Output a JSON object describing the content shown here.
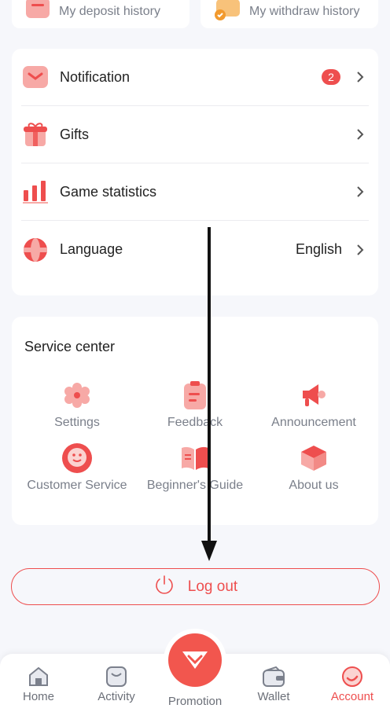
{
  "top": {
    "deposit_history_label": "My deposit history",
    "withdraw_history_label": "My withdraw history"
  },
  "menu": {
    "notification": {
      "label": "Notification",
      "badge": "2"
    },
    "gifts": {
      "label": "Gifts"
    },
    "game_statistics": {
      "label": "Game statistics"
    },
    "language": {
      "label": "Language",
      "value": "English"
    }
  },
  "service_center": {
    "title": "Service center",
    "items": [
      {
        "label": "Settings",
        "icon": "gear-icon"
      },
      {
        "label": "Feedback",
        "icon": "clipboard-icon"
      },
      {
        "label": "Announcement",
        "icon": "megaphone-icon"
      },
      {
        "label": "Customer Service",
        "icon": "chat-face-icon"
      },
      {
        "label": "Beginner's Guide",
        "icon": "book-icon"
      },
      {
        "label": "About us",
        "icon": "cube-icon"
      }
    ]
  },
  "logout_label": "Log out",
  "tabbar": {
    "home": "Home",
    "activity": "Activity",
    "promotion": "Promotion",
    "wallet": "Wallet",
    "account": "Account",
    "active": "account"
  },
  "colors": {
    "accent": "#ee4e4e",
    "icon_light": "#f7a9a6",
    "text_muted": "#7a7f8a"
  }
}
